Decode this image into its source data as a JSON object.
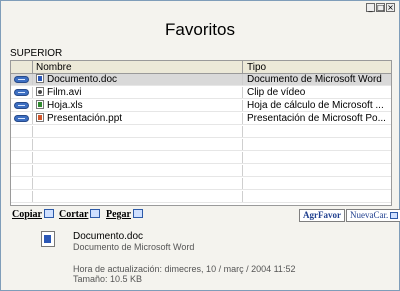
{
  "window": {
    "title": "Favoritos",
    "buttons": {
      "minimize": "_",
      "maximize": "□",
      "close": "×"
    }
  },
  "section_label": "SUPERIOR",
  "table": {
    "columns": [
      "Nombre",
      "Tipo"
    ],
    "rows": [
      {
        "name": "Documento.doc",
        "type": "Documento de Microsoft Word",
        "icon": "word-doc-icon",
        "selected": true
      },
      {
        "name": "Film.avi",
        "type": "Clip de vídeo",
        "icon": "video-file-icon",
        "selected": false
      },
      {
        "name": "Hoja.xls",
        "type": "Hoja de cálculo de Microsoft ...",
        "icon": "excel-file-icon",
        "selected": false
      },
      {
        "name": "Presentación.ppt",
        "type": "Presentación de Microsoft Po...",
        "icon": "powerpoint-file-icon",
        "selected": false
      }
    ]
  },
  "toolbar": {
    "copy": "Copiar",
    "cut": "Cortar",
    "paste": "Pegar",
    "add_favorite": "AgrFavor",
    "new_folder": "NuevaCar."
  },
  "details": {
    "name": "Documento.doc",
    "type": "Documento de Microsoft Word",
    "updated": "Hora de actualización: dimecres, 10 / març / 2004 11:52",
    "size": "Tamaño: 10.5 KB"
  },
  "colors": {
    "background": "#f4f3ee",
    "selected_row": "#d9d9d9",
    "accent_blue": "#3d6fc2"
  }
}
